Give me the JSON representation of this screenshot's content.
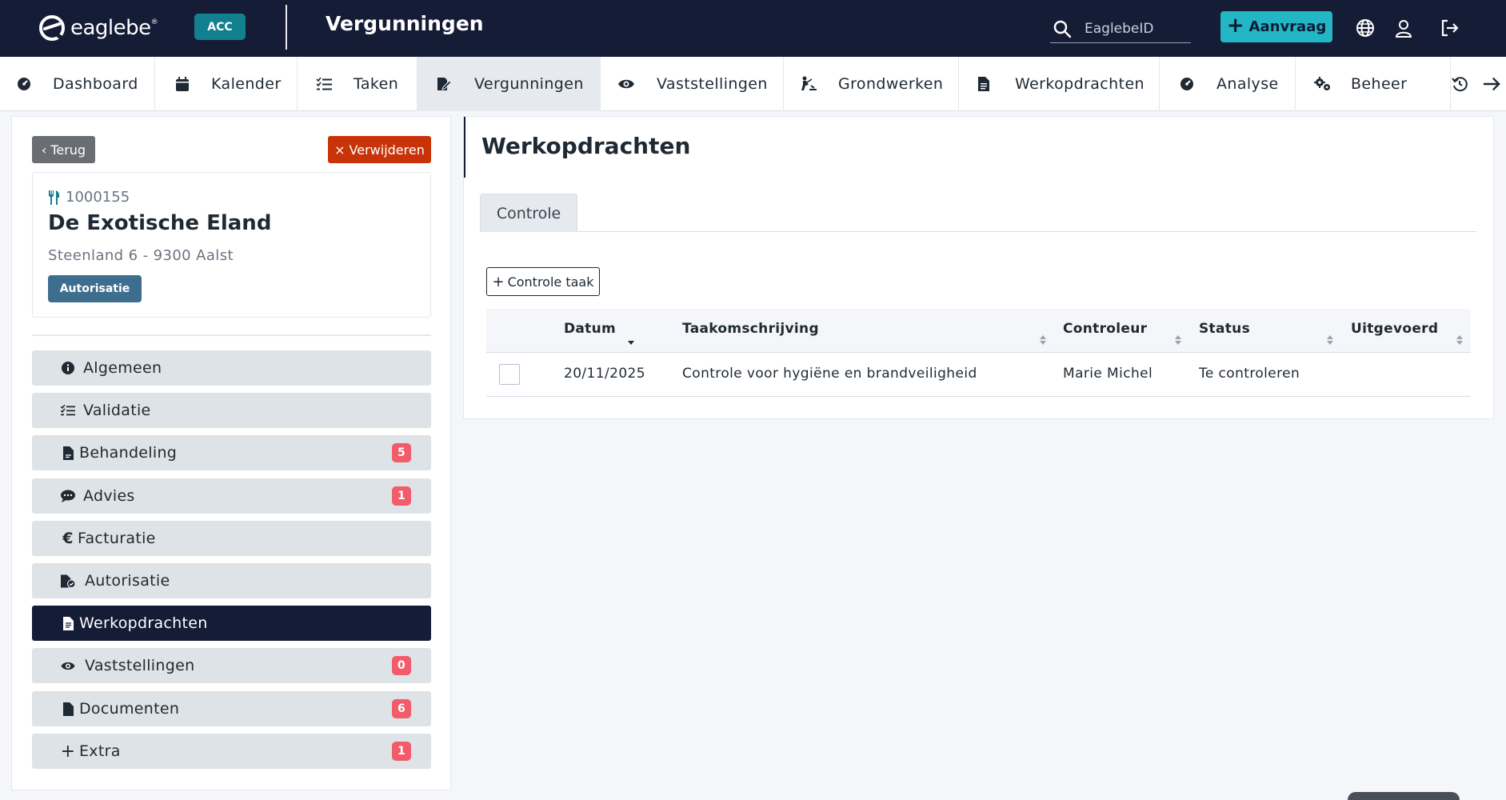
{
  "topbar": {
    "brand": "eaglebe",
    "env_badge": "ACC",
    "page_title": "Vergunningen",
    "search_placeholder": "EaglebeID",
    "new_button": "Aanvraag",
    "icons": [
      "globe-icon",
      "user-icon",
      "logout-icon"
    ]
  },
  "nav": {
    "items": [
      {
        "label": "Dashboard",
        "icon": "dashboard-icon"
      },
      {
        "label": "Kalender",
        "icon": "calendar-icon"
      },
      {
        "label": "Taken",
        "icon": "tasks-icon"
      },
      {
        "label": "Vergunningen",
        "icon": "permit-icon",
        "active": true
      },
      {
        "label": "Vaststellingen",
        "icon": "eye-icon"
      },
      {
        "label": "Grondwerken",
        "icon": "digging-icon"
      },
      {
        "label": "Werkopdrachten",
        "icon": "document-icon"
      },
      {
        "label": "Analyse",
        "icon": "gauge-icon"
      },
      {
        "label": "Beheer",
        "icon": "gears-icon"
      }
    ],
    "extra_icons": [
      "history-icon",
      "arrow-right-icon"
    ]
  },
  "sidebar": {
    "back_button": "Terug",
    "delete_button": "Verwijderen",
    "dossier": {
      "number": "1000155",
      "name": "De Exotische Eland",
      "address": "Steenland 6 - 9300 Aalst",
      "status": "Autorisatie"
    },
    "menu": [
      {
        "label": "Algemeen",
        "icon": "info-icon",
        "count": null
      },
      {
        "label": "Validatie",
        "icon": "checklist-icon",
        "count": null
      },
      {
        "label": "Behandeling",
        "icon": "file-icon",
        "count": "5"
      },
      {
        "label": "Advies",
        "icon": "chat-icon",
        "count": "1"
      },
      {
        "label": "Facturatie",
        "icon": "euro-icon",
        "count": null
      },
      {
        "label": "Autorisatie",
        "icon": "file-check-icon",
        "count": null
      },
      {
        "label": "Werkopdrachten",
        "icon": "document-icon",
        "count": null,
        "active": true
      },
      {
        "label": "Vaststellingen",
        "icon": "eye-icon",
        "count": "0"
      },
      {
        "label": "Documenten",
        "icon": "file-icon",
        "count": "6"
      },
      {
        "label": "Extra",
        "icon": "plus-icon",
        "count": "1"
      }
    ]
  },
  "main": {
    "title": "Werkopdrachten",
    "tab": "Controle",
    "add_button": "Controle taak",
    "table": {
      "headers": [
        "Datum",
        "Taakomschrijving",
        "Controleur",
        "Status",
        "Uitgevoerd"
      ],
      "rows": [
        {
          "datum": "20/11/2025",
          "omschrijving": "Controle voor hygiëne en brandveiligheid",
          "controleur": "Marie Michel",
          "status": "Te controleren",
          "uitgevoerd": ""
        }
      ]
    }
  },
  "colors": {
    "topbar": "#141c36",
    "accent": "#23b6c5",
    "env_badge": "#13808f",
    "danger": "#c8330a",
    "count_badge": "#f25c6a",
    "status_badge": "#3e6e8e"
  }
}
